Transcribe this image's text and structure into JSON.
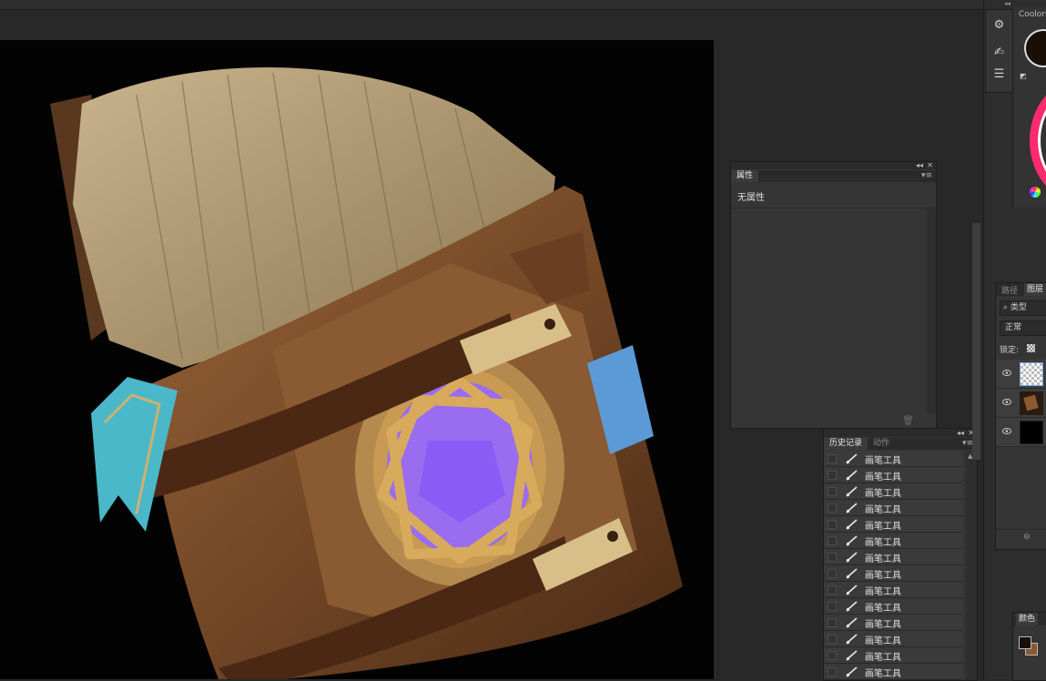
{
  "canvas": {
    "background": "#030303"
  },
  "properties_panel": {
    "tab": "属性",
    "empty_text": "无属性"
  },
  "history_panel": {
    "tabs": [
      "历史记录",
      "动作"
    ],
    "items": [
      "画笔工具",
      "画笔工具",
      "画笔工具",
      "画笔工具",
      "画笔工具",
      "画笔工具",
      "画笔工具",
      "画笔工具",
      "画笔工具",
      "画笔工具",
      "画笔工具",
      "画笔工具",
      "画笔工具",
      "画笔工具"
    ]
  },
  "right_panel": {
    "coolorus_title": "Coolorus",
    "foreground_color": "#1a0e08",
    "wheel_accent": "#ff2a6e"
  },
  "layers_panel": {
    "tabs": [
      "路径",
      "图层"
    ],
    "filter_label": "类型",
    "blend_mode": "正常",
    "lock_label": "锁定:"
  },
  "color_panel": {
    "tab": "颜色",
    "foreground": "#1a0e08",
    "background": "#8a5a2e"
  },
  "icons": {
    "tool_1": "gear-icon",
    "tool_2": "brush-hand-icon",
    "tool_3": "sliders-icon"
  }
}
